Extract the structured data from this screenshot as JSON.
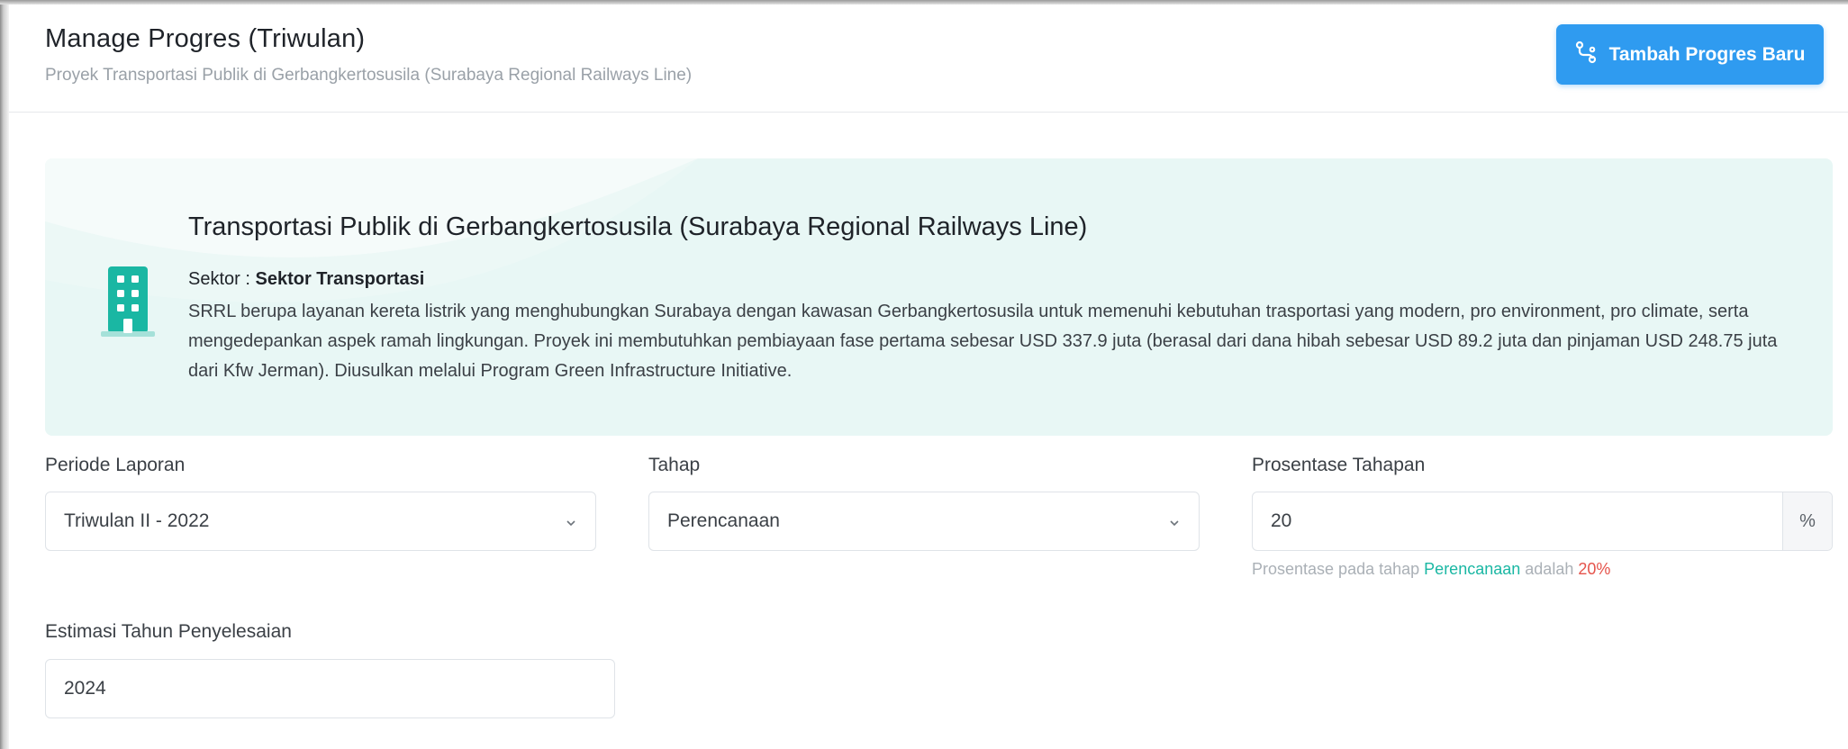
{
  "header": {
    "title": "Manage Progres (Triwulan)",
    "subtitle": "Proyek Transportasi Publik di Gerbangkertosusila (Surabaya Regional Railways Line)",
    "add_button_label": "Tambah Progres Baru",
    "add_button_icon": "route-icon"
  },
  "project": {
    "icon": "building-icon",
    "title": "Transportasi Publik di Gerbangkertosusila (Surabaya Regional Railways Line)",
    "sector_label": "Sektor :",
    "sector_value": "Sektor Transportasi",
    "description": "SRRL berupa layanan kereta listrik yang menghubungkan Surabaya dengan kawasan Gerbangkertosusila untuk memenuhi kebutuhan trasportasi yang modern, pro environment, pro climate, serta mengedepankan aspek ramah lingkungan. Proyek ini membutuhkan pembiayaan fase pertama sebesar USD 337.9 juta (berasal dari dana hibah sebesar USD 89.2 juta dan pinjaman USD 248.75 juta dari Kfw Jerman). Diusulkan melalui Program Green Infrastructure Initiative."
  },
  "form": {
    "periode": {
      "label": "Periode Laporan",
      "value": "Triwulan II - 2022"
    },
    "tahap": {
      "label": "Tahap",
      "value": "Perencanaan"
    },
    "prosentase": {
      "label": "Prosentase Tahapan",
      "value": "20",
      "suffix": "%",
      "help_prefix": "Prosentase pada tahap",
      "help_tahap": "Perencanaan",
      "help_middle": "adalah",
      "help_percent": "20%"
    },
    "estimasi": {
      "label": "Estimasi Tahun Penyelesaian",
      "value": "2024"
    }
  },
  "colors": {
    "primary": "#2f9bf0",
    "teal": "#1ab7a3",
    "card_bg": "#e8f7f5",
    "danger": "#e5534b"
  }
}
